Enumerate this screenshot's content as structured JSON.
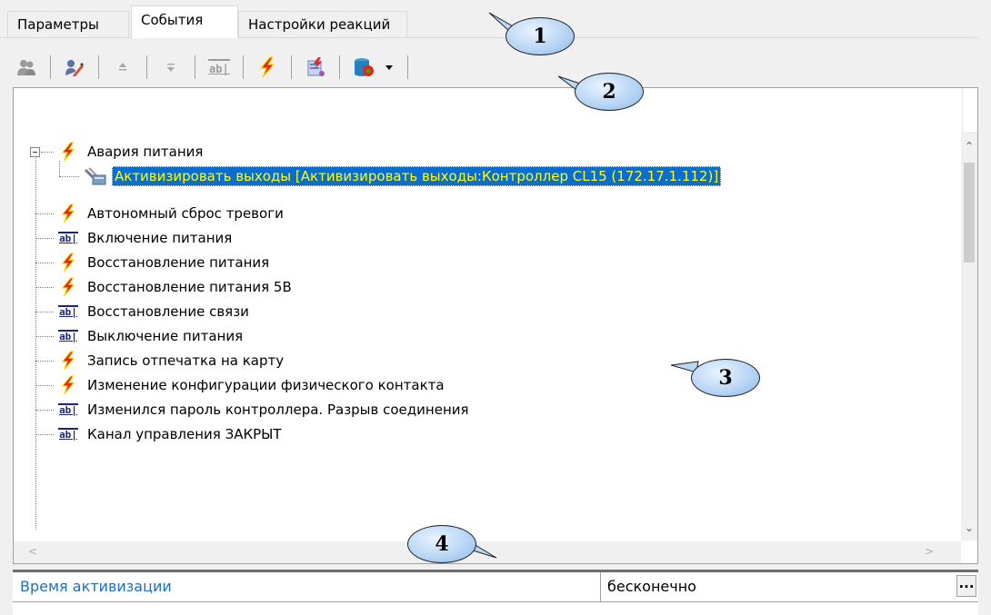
{
  "tabs": [
    {
      "label": "Параметры"
    },
    {
      "label": "События",
      "active": true
    },
    {
      "label": "Настройки реакций"
    }
  ],
  "callouts": [
    "1",
    "2",
    "3",
    "4"
  ],
  "toolbar": {
    "buttons": [
      {
        "icon": "add-group-icon",
        "enabled": false
      },
      {
        "icon": "edit-icon",
        "enabled": true
      },
      {
        "icon": "move-up-icon",
        "enabled": false
      },
      {
        "icon": "move-down-icon",
        "enabled": false
      },
      {
        "icon": "text-field-icon",
        "enabled": false
      },
      {
        "icon": "lightning-icon",
        "enabled": true
      },
      {
        "icon": "reaction-icon",
        "enabled": true
      },
      {
        "icon": "database-icon",
        "enabled": true,
        "dropdown": true
      }
    ]
  },
  "tree": {
    "items": [
      {
        "label": "Авария питания",
        "icon": "lightning-icon",
        "expanded": true
      },
      {
        "label": "Активизировать выходы [Активизировать выходы:Контроллер CL15 (172.17.1.112)]",
        "icon": "output-reaction-icon",
        "selected": true,
        "child": true
      },
      {
        "label": "Автономный сброс тревоги",
        "icon": "lightning-icon"
      },
      {
        "label": "Включение питания",
        "icon": "text-field-icon"
      },
      {
        "label": "Восстановление питания",
        "icon": "lightning-icon"
      },
      {
        "label": "Восстановление питания 5В",
        "icon": "lightning-icon"
      },
      {
        "label": "Восстановление связи",
        "icon": "text-field-icon"
      },
      {
        "label": "Выключение питания",
        "icon": "text-field-icon"
      },
      {
        "label": "Запись отпечатка на карту",
        "icon": "lightning-icon"
      },
      {
        "label": "Изменение конфигурации физического контакта",
        "icon": "lightning-icon"
      },
      {
        "label": "Изменился пароль контроллера. Разрыв соединения",
        "icon": "text-field-icon"
      },
      {
        "label": "Канал управления ЗАКРЫТ",
        "icon": "text-field-icon"
      }
    ]
  },
  "properties": {
    "name": "Время активизации",
    "value": "бесконечно",
    "button_label": "..."
  },
  "colors": {
    "selection": "#0a6ed1",
    "selection_text": "#ffff00",
    "property_name": "#1e6fbf",
    "lightning": "#e3261b"
  }
}
